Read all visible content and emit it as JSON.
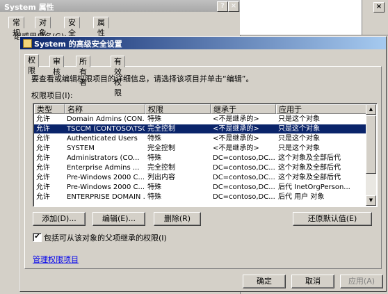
{
  "background_window": {
    "title": "System 属性",
    "tabs": [
      "常规",
      "对象",
      "安全",
      "属性编辑器"
    ],
    "group_label": "组或用户名(G):"
  },
  "dialog": {
    "title": "System 的高级安全设置",
    "tabs": [
      "权限",
      "审核",
      "所有者",
      "有效权限"
    ],
    "description": "要查看或编辑权限项目的详细信息，请选择该项目并单击“编辑”。",
    "list_label": "权限项目(I):",
    "columns": [
      "类型",
      "名称",
      "权限",
      "继承于",
      "应用于"
    ],
    "rows": [
      {
        "type": "允许",
        "name": "Domain Admins (CON...",
        "perm": "特殊",
        "inherit": "<不是继承的>",
        "apply": "只是这个对象"
      },
      {
        "type": "允许",
        "name": "TSCCM (CONTOSO\\TSC...",
        "perm": "完全控制",
        "inherit": "<不是继承的>",
        "apply": "只是这个对象"
      },
      {
        "type": "允许",
        "name": "Authenticated Users",
        "perm": "特殊",
        "inherit": "<不是继承的>",
        "apply": "只是这个对象"
      },
      {
        "type": "允许",
        "name": "SYSTEM",
        "perm": "完全控制",
        "inherit": "<不是继承的>",
        "apply": "只是这个对象"
      },
      {
        "type": "允许",
        "name": "Administrators (CO...",
        "perm": "特殊",
        "inherit": "DC=contoso,DC...",
        "apply": "这个对象及全部后代"
      },
      {
        "type": "允许",
        "name": "Enterprise Admins ...",
        "perm": "完全控制",
        "inherit": "DC=contoso,DC...",
        "apply": "这个对象及全部后代"
      },
      {
        "type": "允许",
        "name": "Pre-Windows 2000 C...",
        "perm": "列出内容",
        "inherit": "DC=contoso,DC...",
        "apply": "这个对象及全部后代"
      },
      {
        "type": "允许",
        "name": "Pre-Windows 2000 C...",
        "perm": "特殊",
        "inherit": "DC=contoso,DC...",
        "apply": "后代 InetOrgPerson..."
      },
      {
        "type": "允许",
        "name": "ENTERPRISE DOMAIN ...",
        "perm": "特殊",
        "inherit": "DC=contoso,DC...",
        "apply": "后代 用户 对象"
      }
    ],
    "selected_row": 1,
    "buttons": {
      "add": "添加(D)...",
      "edit": "编辑(E)...",
      "remove": "删除(R)",
      "restore": "还原默认值(E)"
    },
    "checkbox_label": "包括可从该对象的父项继承的权限(I)",
    "checkbox_checked": true,
    "link": "管理权限项目",
    "footer": {
      "ok": "确定",
      "cancel": "取消",
      "apply": "应用(A)"
    }
  },
  "colors": {
    "selection": "#0a246a",
    "titlebar": "#0a246a",
    "face": "#d4d0c8"
  }
}
